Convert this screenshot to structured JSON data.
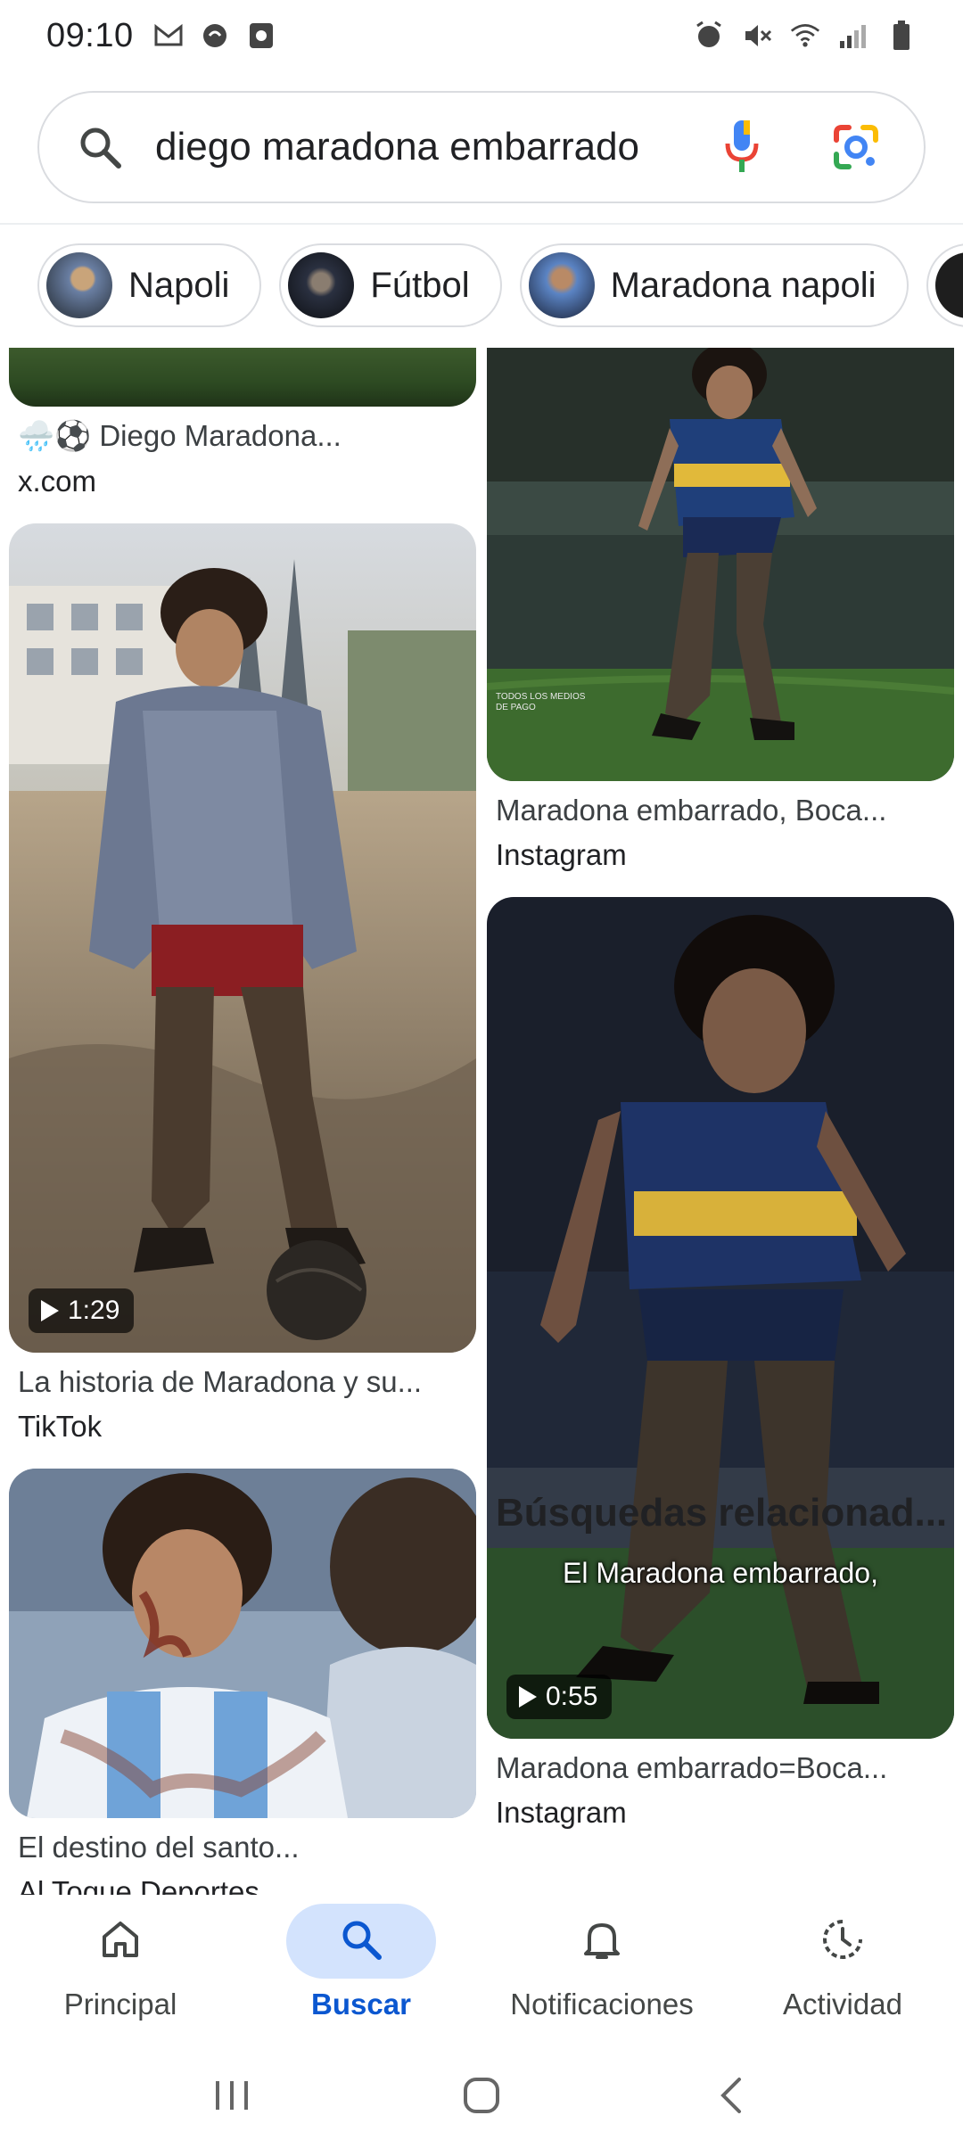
{
  "status_bar": {
    "time": "09:10",
    "left_icons": [
      "gmail-icon",
      "whatsapp-icon",
      "screen-record-icon"
    ],
    "right_icons": [
      "alarm-icon",
      "mute-icon",
      "wifi-icon",
      "signal-icon",
      "battery-icon"
    ]
  },
  "search": {
    "query": "diego maradona embarrado"
  },
  "chips": [
    {
      "label": "Napoli"
    },
    {
      "label": "Fútbol"
    },
    {
      "label": "Maradona napoli"
    }
  ],
  "results": {
    "left": [
      {
        "title": "🌧️⚽ Diego Maradona...",
        "source": "x.com"
      },
      {
        "title": "La historia de Maradona y su...",
        "source": "TikTok",
        "duration": "1:29"
      },
      {
        "title": "El destino del santo...",
        "source": "Al Toque Deportes"
      }
    ],
    "right": [
      {
        "title": "Maradona embarrado, Boca...",
        "source": "Instagram",
        "watermark": "TODOS LOS MEDIOS DE PAGO"
      },
      {
        "title": "Maradona embarrado=Boca...",
        "source": "Instagram",
        "duration": "0:55",
        "caption": "El Maradona embarrado,"
      }
    ]
  },
  "related_heading": "Búsquedas relacionad...",
  "bottom_nav": [
    {
      "label": "Principal",
      "icon": "home-icon",
      "active": false
    },
    {
      "label": "Buscar",
      "icon": "search-icon",
      "active": true
    },
    {
      "label": "Notificaciones",
      "icon": "bell-icon",
      "active": false
    },
    {
      "label": "Actividad",
      "icon": "activity-icon",
      "active": false
    }
  ],
  "colors": {
    "accent": "#0b57d0",
    "active_pill": "#d3e3fd",
    "border": "#dadce0"
  }
}
